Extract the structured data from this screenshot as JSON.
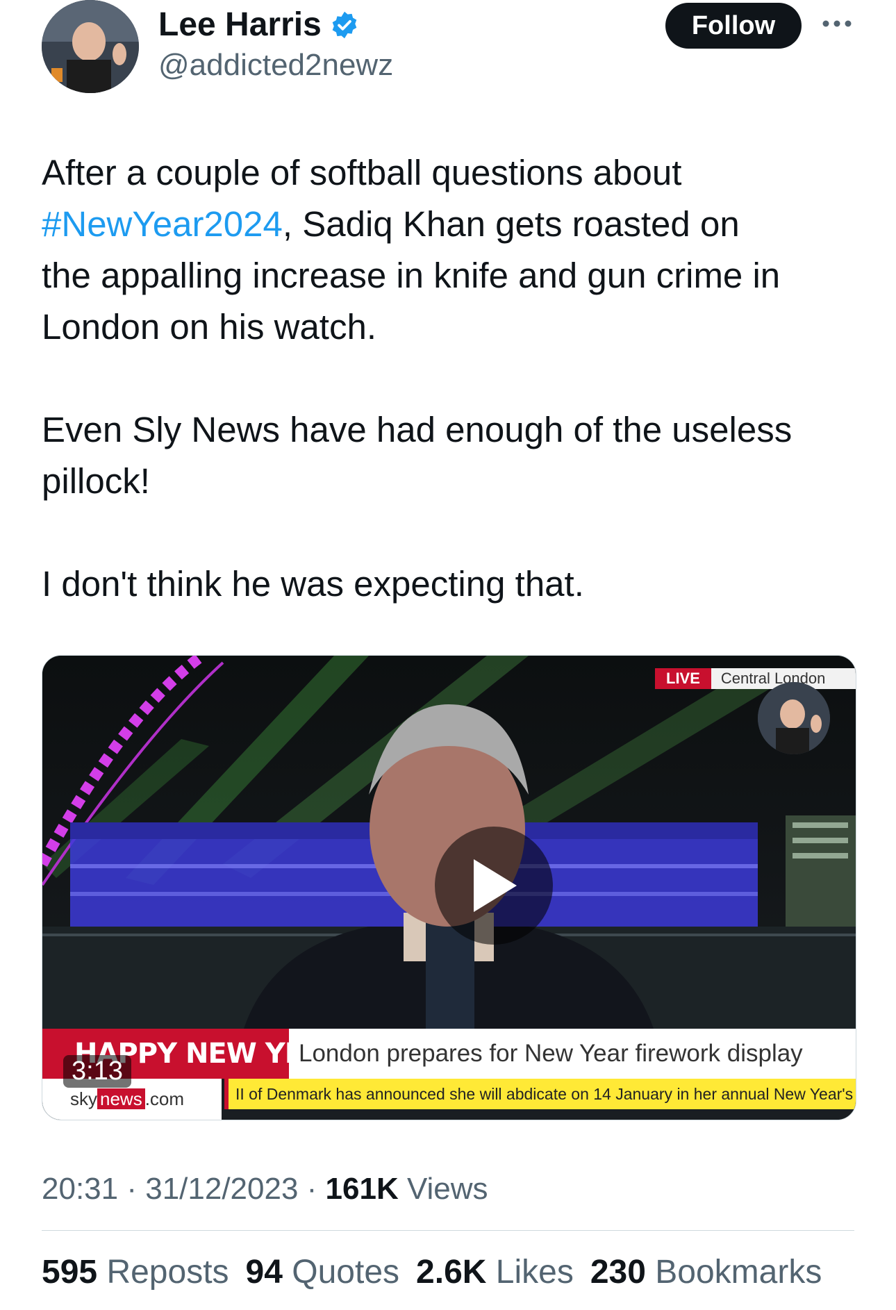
{
  "author": {
    "name": "Lee Harris",
    "handle": "@addicted2newz",
    "verified_color": "#1d9bf0"
  },
  "actions": {
    "follow_label": "Follow",
    "more_icon": "more-icon"
  },
  "tweet": {
    "line1": "After a couple of softball questions about",
    "hashtag": "#NewYear2024",
    "line2_rest": ", Sadiq Khan gets roasted on",
    "line3": "the appalling increase in knife and gun crime in",
    "line4": "London on his watch.",
    "para2_line1": "Even Sly News have had enough of the useless",
    "para2_line2": "pillock!",
    "para3": "I don't think he was expecting that."
  },
  "video": {
    "duration": "3:13",
    "live_label": "LIVE",
    "location": "Central London",
    "banner": "HAPPY NEW YEAR",
    "headline": "London prepares for New Year firework display",
    "brand_sky": "sky",
    "brand_news": "news",
    "brand_com": ".com",
    "ticker": "II of Denmark has announced she will abdicate on 14 January in her annual New Year's"
  },
  "meta": {
    "time": "20:31",
    "sep1": " · ",
    "date": "31/12/2023",
    "sep2": " · ",
    "views_count": "161K",
    "views_label": " Views"
  },
  "stats": {
    "reposts_count": "595",
    "reposts_label": "Reposts",
    "quotes_count": "94",
    "quotes_label": "Quotes",
    "likes_count": "2.6K",
    "likes_label": "Likes",
    "bookmarks_count": "230",
    "bookmarks_label": "Bookmarks"
  },
  "colors": {
    "link": "#1d9bf0",
    "secondary_text": "#536471",
    "sky_red": "#c8102e",
    "ticker_yellow": "#ffe936"
  }
}
